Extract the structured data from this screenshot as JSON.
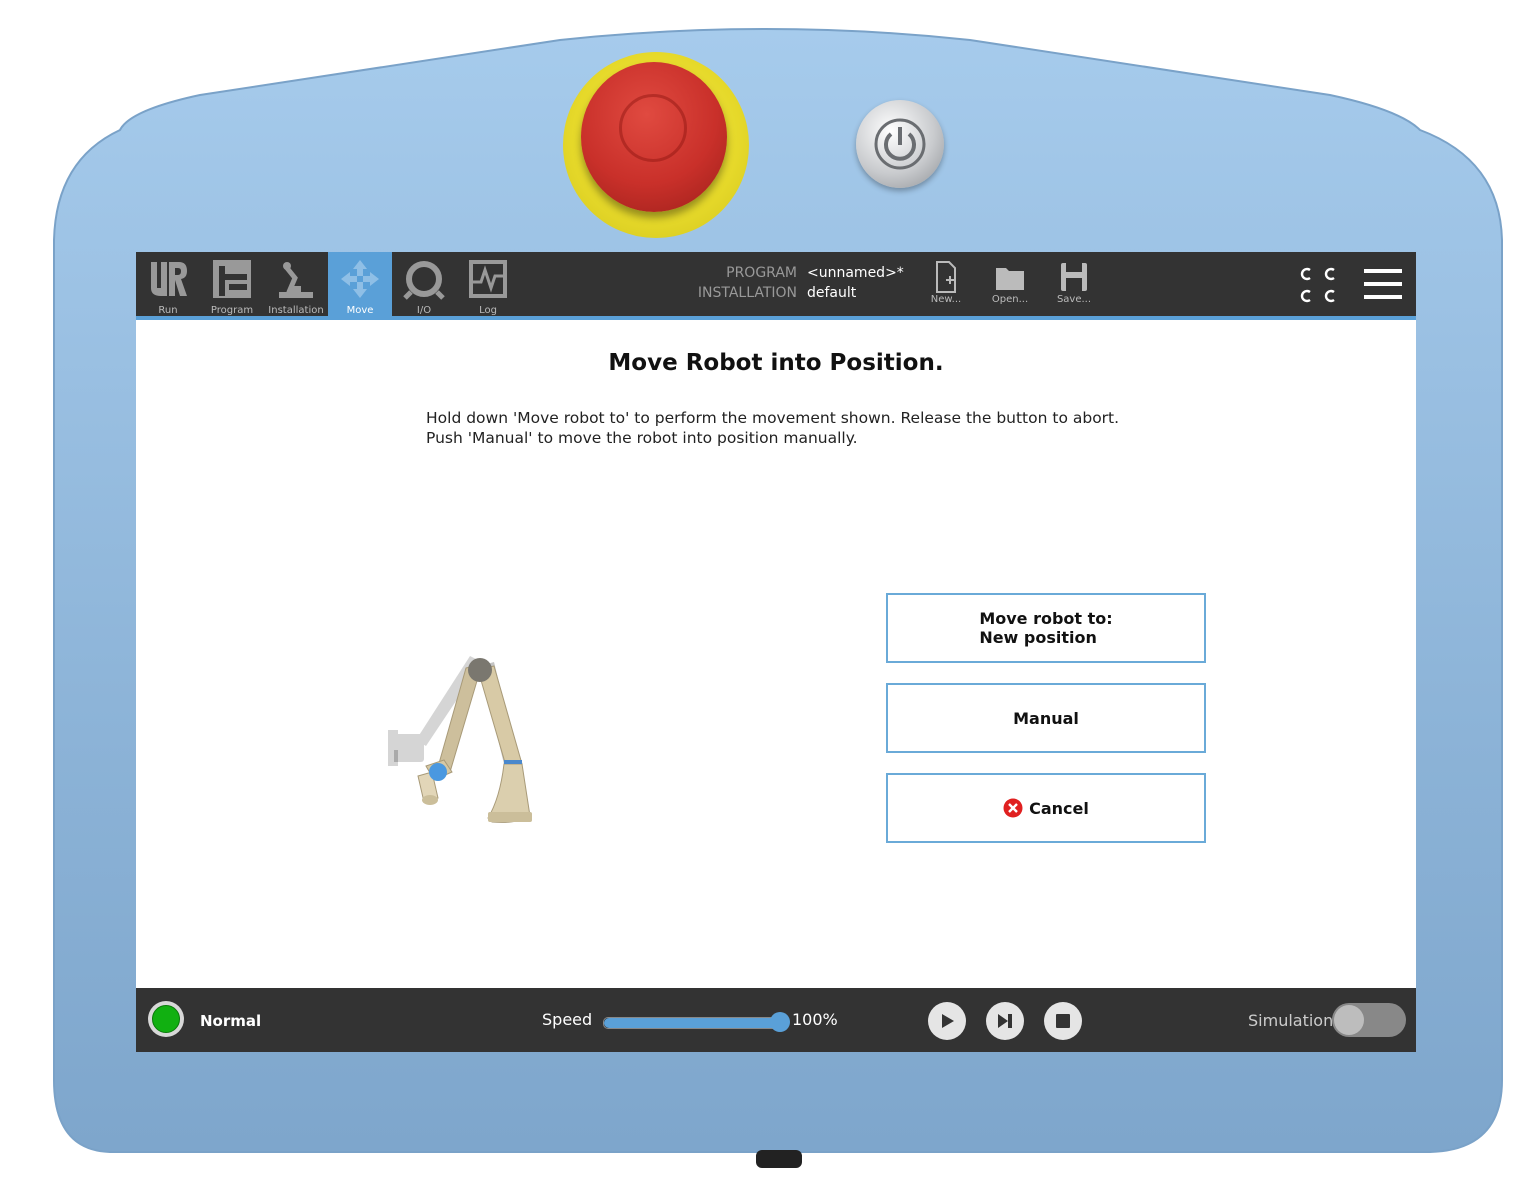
{
  "nav": {
    "tabs": [
      {
        "label": "Run",
        "icon": "ur-logo-icon"
      },
      {
        "label": "Program",
        "icon": "program-icon"
      },
      {
        "label": "Installation",
        "icon": "robot-arm-icon"
      },
      {
        "label": "Move",
        "icon": "move-arrows-icon"
      },
      {
        "label": "I/O",
        "icon": "io-icon"
      },
      {
        "label": "Log",
        "icon": "log-icon"
      }
    ],
    "active_tab": "Move"
  },
  "program_info": {
    "program_label": "PROGRAM",
    "program_value": "<unnamed>*",
    "installation_label": "INSTALLATION",
    "installation_value": "default"
  },
  "file_buttons": {
    "new": "New...",
    "open": "Open...",
    "save": "Save..."
  },
  "header_right": {
    "cc_text": "C C",
    "menu_icon": "hamburger-menu-icon"
  },
  "dialog": {
    "title": "Move Robot into Position.",
    "line1": "Hold down 'Move robot to' to perform the movement shown. Release the button to abort.",
    "line2": "Push 'Manual' to move the robot into position manually.",
    "move_line1": "Move robot to:",
    "move_line2": "New position",
    "manual": "Manual",
    "cancel": "Cancel"
  },
  "footer": {
    "status": "Normal",
    "speed_label": "Speed",
    "speed_value": "100%",
    "speed_fraction": 1.0,
    "simulation_label": "Simulation",
    "simulation_on": false
  },
  "colors": {
    "accent": "#5aa0d8",
    "bar": "#333333",
    "status_ok": "#11b011",
    "cancel": "#e02020",
    "pendant": "#8fb8dd"
  }
}
